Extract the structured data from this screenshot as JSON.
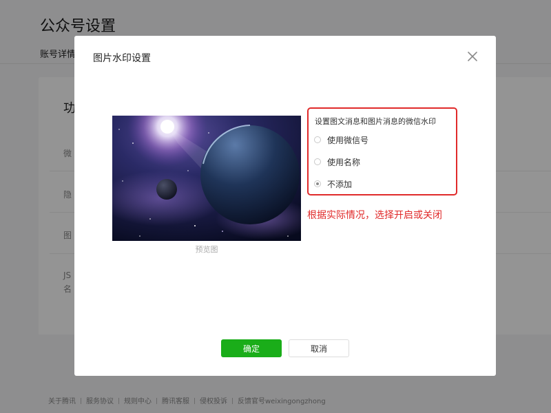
{
  "background_page": {
    "title": "公众号设置",
    "tab_label": "账号详情",
    "card_heading": "功",
    "row_fragments": [
      "微",
      "隐",
      "图",
      "JS",
      "名"
    ]
  },
  "dialog": {
    "title": "图片水印设置",
    "preview_caption": "预览图",
    "options_heading": "设置图文消息和图片消息的微信水印",
    "options": [
      {
        "label": "使用微信号",
        "checked": false
      },
      {
        "label": "使用名称",
        "checked": false
      },
      {
        "label": "不添加",
        "checked": true
      }
    ],
    "annotation": "根据实际情况，选择开启或关闭",
    "confirm_label": "确定",
    "cancel_label": "取消"
  },
  "footer": {
    "links": [
      "关于腾讯",
      "服务协议",
      "规则中心",
      "腾讯客服",
      "侵权投诉",
      "反馈官号weixingongzhong"
    ]
  },
  "icons": {
    "close": "close-icon"
  },
  "colors": {
    "primary_button": "#1aad19",
    "annotation_red": "#e02929",
    "overlay": "rgba(0,0,0,0.42)"
  }
}
